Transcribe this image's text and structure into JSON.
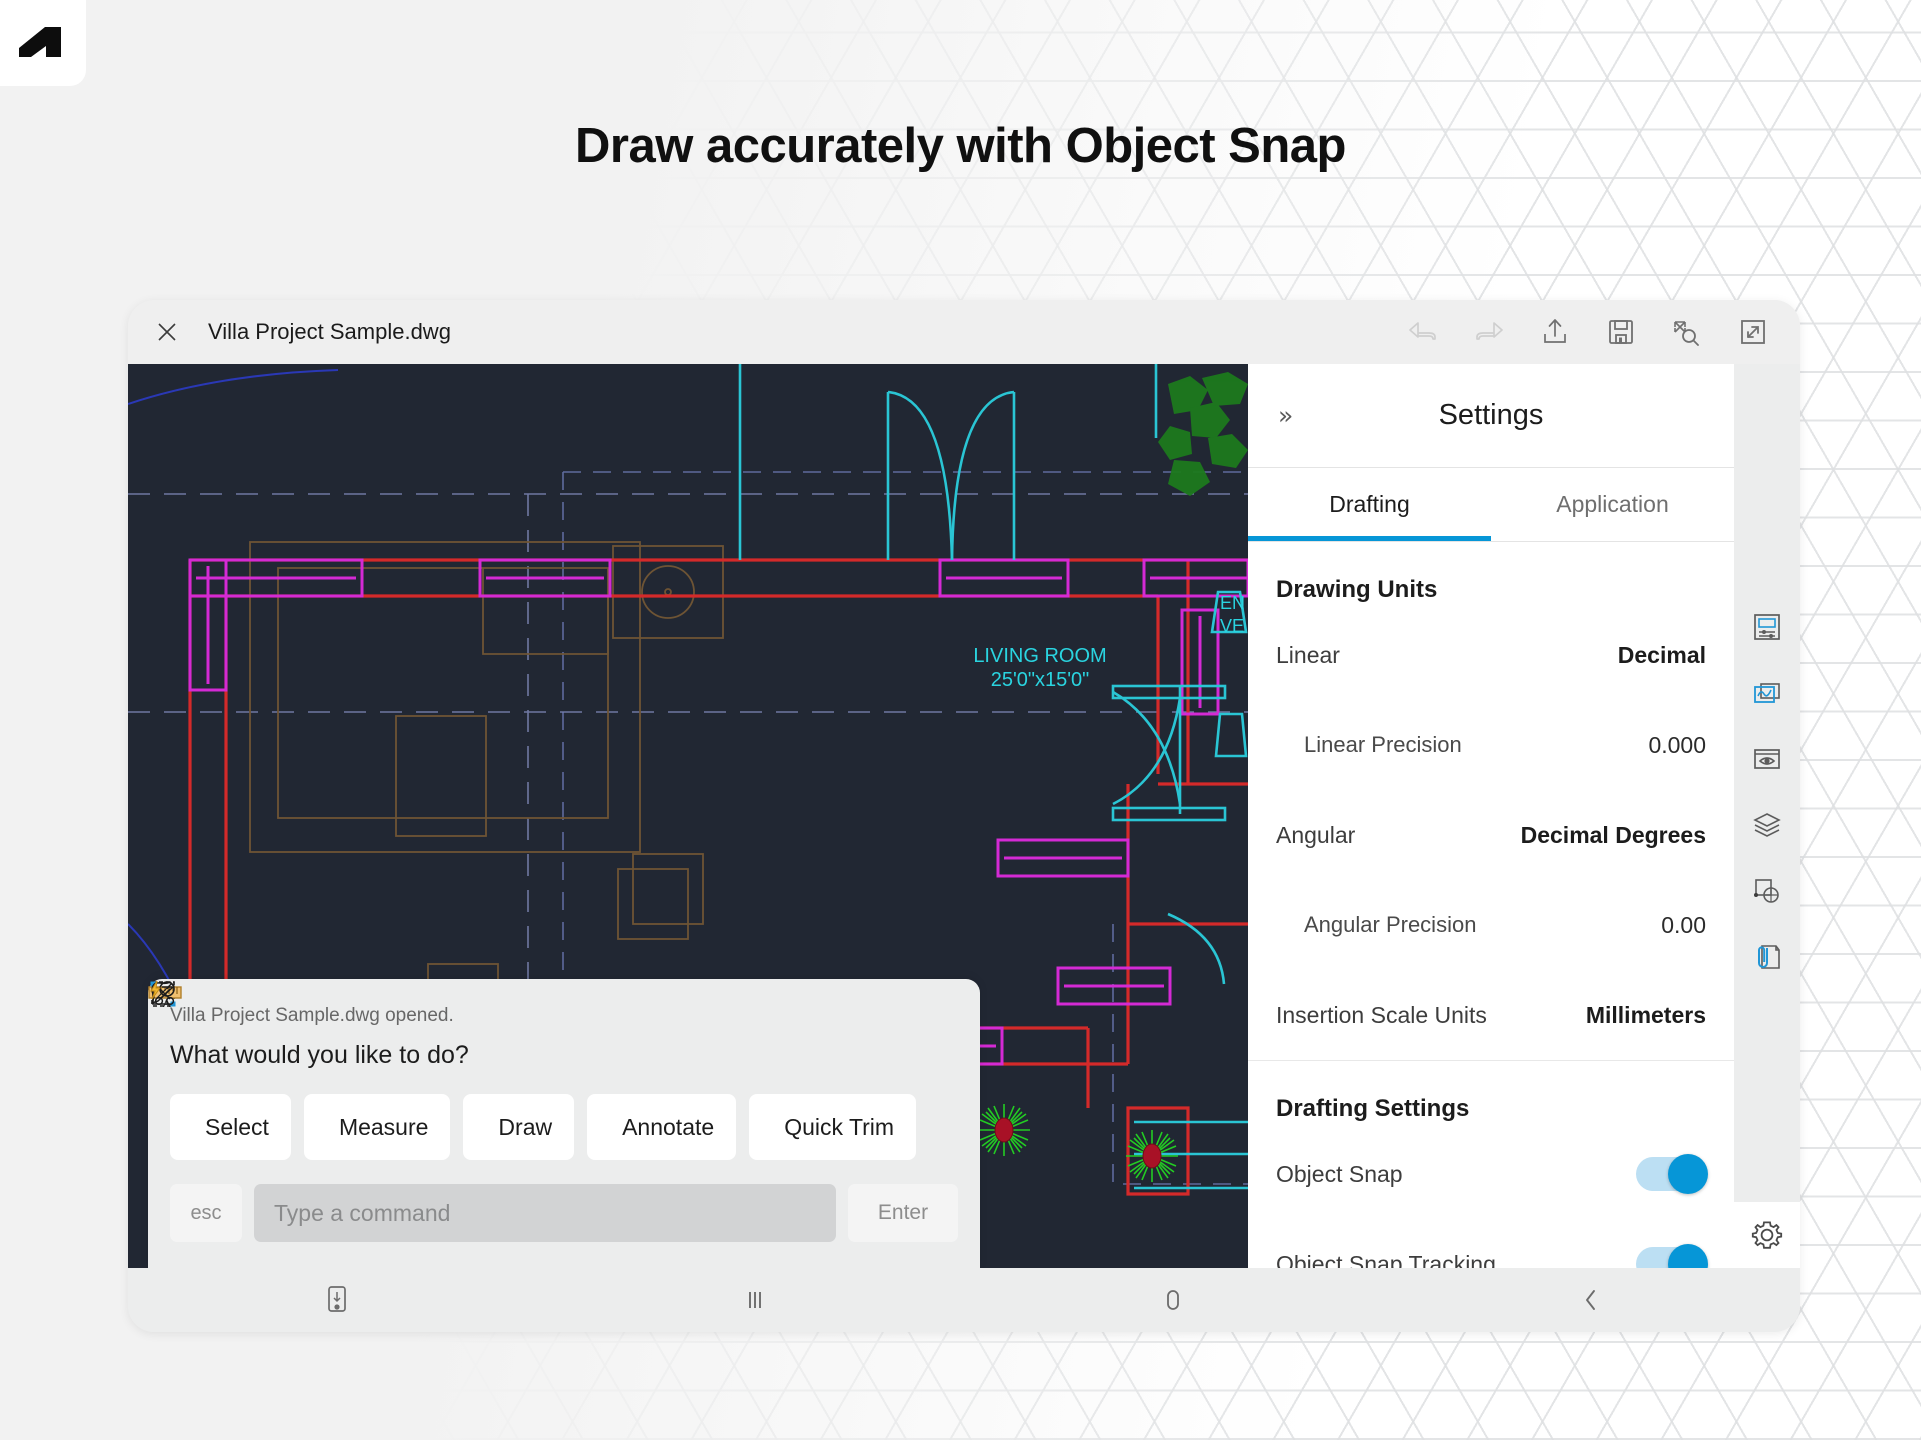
{
  "page": {
    "title": "Draw accurately with Object Snap",
    "logo_name": "autodesk-logo"
  },
  "titlebar": {
    "close_icon": "close-icon",
    "filename": "Villa Project Sample.dwg",
    "tools": [
      {
        "name": "undo-icon",
        "disabled": true
      },
      {
        "name": "redo-icon",
        "disabled": true
      },
      {
        "name": "share-icon",
        "disabled": false
      },
      {
        "name": "save-icon",
        "disabled": false
      },
      {
        "name": "zoom-extents-icon",
        "disabled": false
      },
      {
        "name": "fullscreen-icon",
        "disabled": false
      }
    ]
  },
  "canvas": {
    "room_label": "LIVING ROOM",
    "room_dims": "25'0\"x15'0\"",
    "clipped_label_line1": "EN",
    "clipped_label_line2": "VE",
    "bg_color": "#212733",
    "wall_color": "#d42a2a",
    "window_color": "#d42ad4",
    "door_color": "#2ac5d4",
    "text_color": "#2ad4e0",
    "plant_color": "#22cc22",
    "plant_center_color": "#b01020"
  },
  "settings": {
    "collapse_icon_glyph": "»",
    "title": "Settings",
    "tabs": [
      {
        "label": "Drafting",
        "active": true
      },
      {
        "label": "Application",
        "active": false
      }
    ],
    "sections": [
      {
        "heading": "Drawing Units",
        "rows": [
          {
            "label": "Linear",
            "value": "Decimal",
            "indent": false,
            "type": "value"
          },
          {
            "label": "Linear Precision",
            "value": "0.000",
            "indent": true,
            "type": "value"
          },
          {
            "label": "Angular",
            "value": "Decimal Degrees",
            "indent": false,
            "type": "value"
          },
          {
            "label": "Angular Precision",
            "value": "0.00",
            "indent": true,
            "type": "value"
          },
          {
            "label": "Insertion Scale Units",
            "value": "Millimeters",
            "indent": false,
            "type": "value"
          }
        ]
      },
      {
        "heading": "Drafting Settings",
        "rows": [
          {
            "label": "Object Snap",
            "value": "on",
            "indent": false,
            "type": "toggle"
          },
          {
            "label": "Object Snap Tracking",
            "value": "on",
            "indent": true,
            "type": "toggle"
          }
        ]
      }
    ],
    "accent_color": "#0696d7"
  },
  "rail": {
    "items": [
      {
        "name": "properties-panel-icon",
        "accent": false,
        "active_bg": false
      },
      {
        "name": "viewports-icon",
        "accent": true,
        "active_bg": false
      },
      {
        "name": "visibility-eye-icon",
        "accent": false,
        "active_bg": false
      },
      {
        "name": "layers-icon",
        "accent": false,
        "active_bg": false
      },
      {
        "name": "blocks-icon",
        "accent": false,
        "active_bg": false
      },
      {
        "name": "attachments-icon",
        "accent": true,
        "active_bg": false
      },
      {
        "name": "settings-gear-icon",
        "accent": false,
        "active_bg": true
      }
    ]
  },
  "command_panel": {
    "status": "Villa Project Sample.dwg opened.",
    "prompt": "What would you like to do?",
    "actions": [
      {
        "label": "Select",
        "icon": "select-marquee-icon"
      },
      {
        "label": "Measure",
        "icon": "ruler-icon"
      },
      {
        "label": "Draw",
        "icon": "draw-polyline-icon"
      },
      {
        "label": "Annotate",
        "icon": "annotate-pen-icon"
      },
      {
        "label": "Quick Trim",
        "icon": "quick-trim-scissors-icon"
      }
    ],
    "esc_label": "esc",
    "input_value": "",
    "input_placeholder": "Type a command",
    "enter_label": "Enter"
  },
  "navbar": {
    "items": [
      {
        "name": "screenshot-icon"
      },
      {
        "name": "recents-icon"
      },
      {
        "name": "home-icon"
      },
      {
        "name": "back-icon"
      }
    ]
  }
}
